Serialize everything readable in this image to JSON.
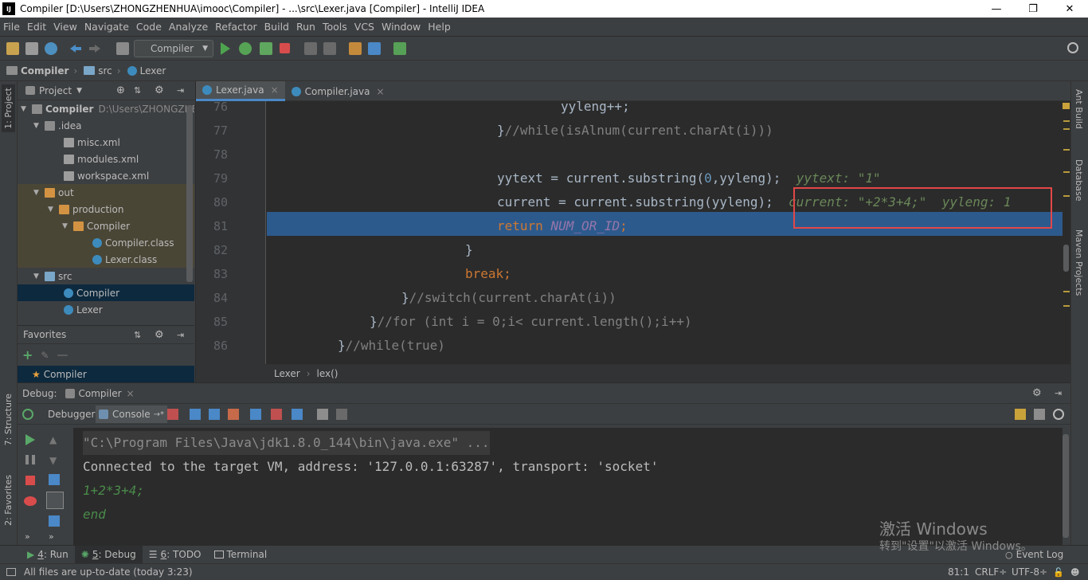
{
  "window": {
    "title": "Compiler [D:\\Users\\ZHONGZHENHUA\\imooc\\Compiler] - ...\\src\\Lexer.java [Compiler] - IntelliJ IDEA",
    "logo": "IJ",
    "controls": [
      "minimize-icon",
      "restore-icon",
      "close-icon"
    ]
  },
  "menu": [
    "File",
    "Edit",
    "View",
    "Navigate",
    "Code",
    "Analyze",
    "Refactor",
    "Build",
    "Run",
    "Tools",
    "VCS",
    "Window",
    "Help"
  ],
  "toolbar": {
    "run_config": "Compiler"
  },
  "breadcrumb": [
    "Compiler",
    "src",
    "Lexer"
  ],
  "project_panel": {
    "title": "Project",
    "tree": [
      {
        "label": "Compiler",
        "detail": "D:\\Users\\ZHONGZHE",
        "depth": 0,
        "expanded": true,
        "icon": "folder"
      },
      {
        "label": ".idea",
        "depth": 1,
        "expanded": true,
        "icon": "folder"
      },
      {
        "label": "misc.xml",
        "depth": 2,
        "icon": "xml"
      },
      {
        "label": "modules.xml",
        "depth": 2,
        "icon": "xml"
      },
      {
        "label": "workspace.xml",
        "depth": 2,
        "icon": "xml"
      },
      {
        "label": "out",
        "depth": 1,
        "expanded": true,
        "icon": "folder-orange"
      },
      {
        "label": "production",
        "depth": 2,
        "expanded": true,
        "icon": "folder-orange"
      },
      {
        "label": "Compiler",
        "depth": 3,
        "expanded": true,
        "icon": "folder-orange"
      },
      {
        "label": "Compiler.class",
        "depth": 4,
        "icon": "class"
      },
      {
        "label": "Lexer.class",
        "depth": 4,
        "icon": "class"
      },
      {
        "label": "src",
        "depth": 1,
        "expanded": true,
        "icon": "folder-blue"
      },
      {
        "label": "Compiler",
        "depth": 2,
        "icon": "class",
        "selected": true
      },
      {
        "label": "Lexer",
        "depth": 2,
        "icon": "class"
      }
    ],
    "favorites_title": "Favorites",
    "favorites_item": "Compiler"
  },
  "left_tool_tabs": [
    "1: Project",
    "7: Structure",
    "2: Favorites"
  ],
  "right_tool_tabs": [
    "Ant Build",
    "Database",
    "Maven Projects"
  ],
  "editor": {
    "tabs": [
      {
        "label": "Lexer.java",
        "active": true
      },
      {
        "label": "Compiler.java",
        "active": false
      }
    ],
    "lines": [
      {
        "n": "76"
      },
      {
        "n": "77"
      },
      {
        "n": "78"
      },
      {
        "n": "79"
      },
      {
        "n": "80"
      },
      {
        "n": "81"
      },
      {
        "n": "82"
      },
      {
        "n": "83"
      },
      {
        "n": "84"
      },
      {
        "n": "85"
      },
      {
        "n": "86"
      }
    ],
    "code": {
      "l76": "yyleng++;",
      "l77_a": "}",
      "l77_b": "//while(isAlnum(current.charAt(i)))",
      "l79_a": "yytext = current.substring(",
      "l79_b": "0",
      "l79_c": ",yyleng);",
      "l79_dbg": "yytext: \"1\"",
      "l80_a": "current = current.substring(yyleng);",
      "l80_dbg": "current: \"+2*3+4;\"  yyleng: 1",
      "l81_kw": "return",
      "l81_const": "NUM_OR_ID",
      "l81_semi": ";",
      "l82": "}",
      "l83_kw": "break",
      "l83_semi": ";",
      "l84_a": "}",
      "l84_b": "//switch(current.charAt(i))",
      "l85_a": "}",
      "l85_b": "//for (int i = 0;i< current.length();i++)",
      "l86_a": "}",
      "l86_b": "//while(true)"
    },
    "crumbs": [
      "Lexer",
      "lex()"
    ]
  },
  "debug": {
    "label": "Debug:",
    "session": "Compiler",
    "tabs": [
      "Debugger",
      "Console"
    ],
    "console": [
      "\"C:\\Program Files\\Java\\jdk1.8.0_144\\bin\\java.exe\" ...",
      "Connected to the target VM, address: '127.0.0.1:63287', transport: 'socket'",
      "1+2*3+4;",
      "end"
    ]
  },
  "bottom_tabs": [
    {
      "num": "4",
      "label": ": Run"
    },
    {
      "num": "5",
      "label": ": Debug"
    },
    {
      "num": "6",
      "label": ": TODO"
    },
    {
      "num": "",
      "label": "Terminal"
    }
  ],
  "event_log": "Event Log",
  "status": {
    "message": "All files are up-to-date (today 3:23)",
    "position": "81:1",
    "line_sep": "CRLF÷",
    "encoding": "UTF-8÷"
  },
  "watermark": {
    "line1": "激活 Windows",
    "line2": "转到\"设置\"以激活 Windows。"
  },
  "colors": {
    "editor_bg": "#2b2b2b",
    "keyword": "#cc7832",
    "comment": "#808080",
    "constant": "#9876aa",
    "debug_value": "#6a8759",
    "highlight_line": "#2d5a8d",
    "annotation_box": "#e24747"
  }
}
